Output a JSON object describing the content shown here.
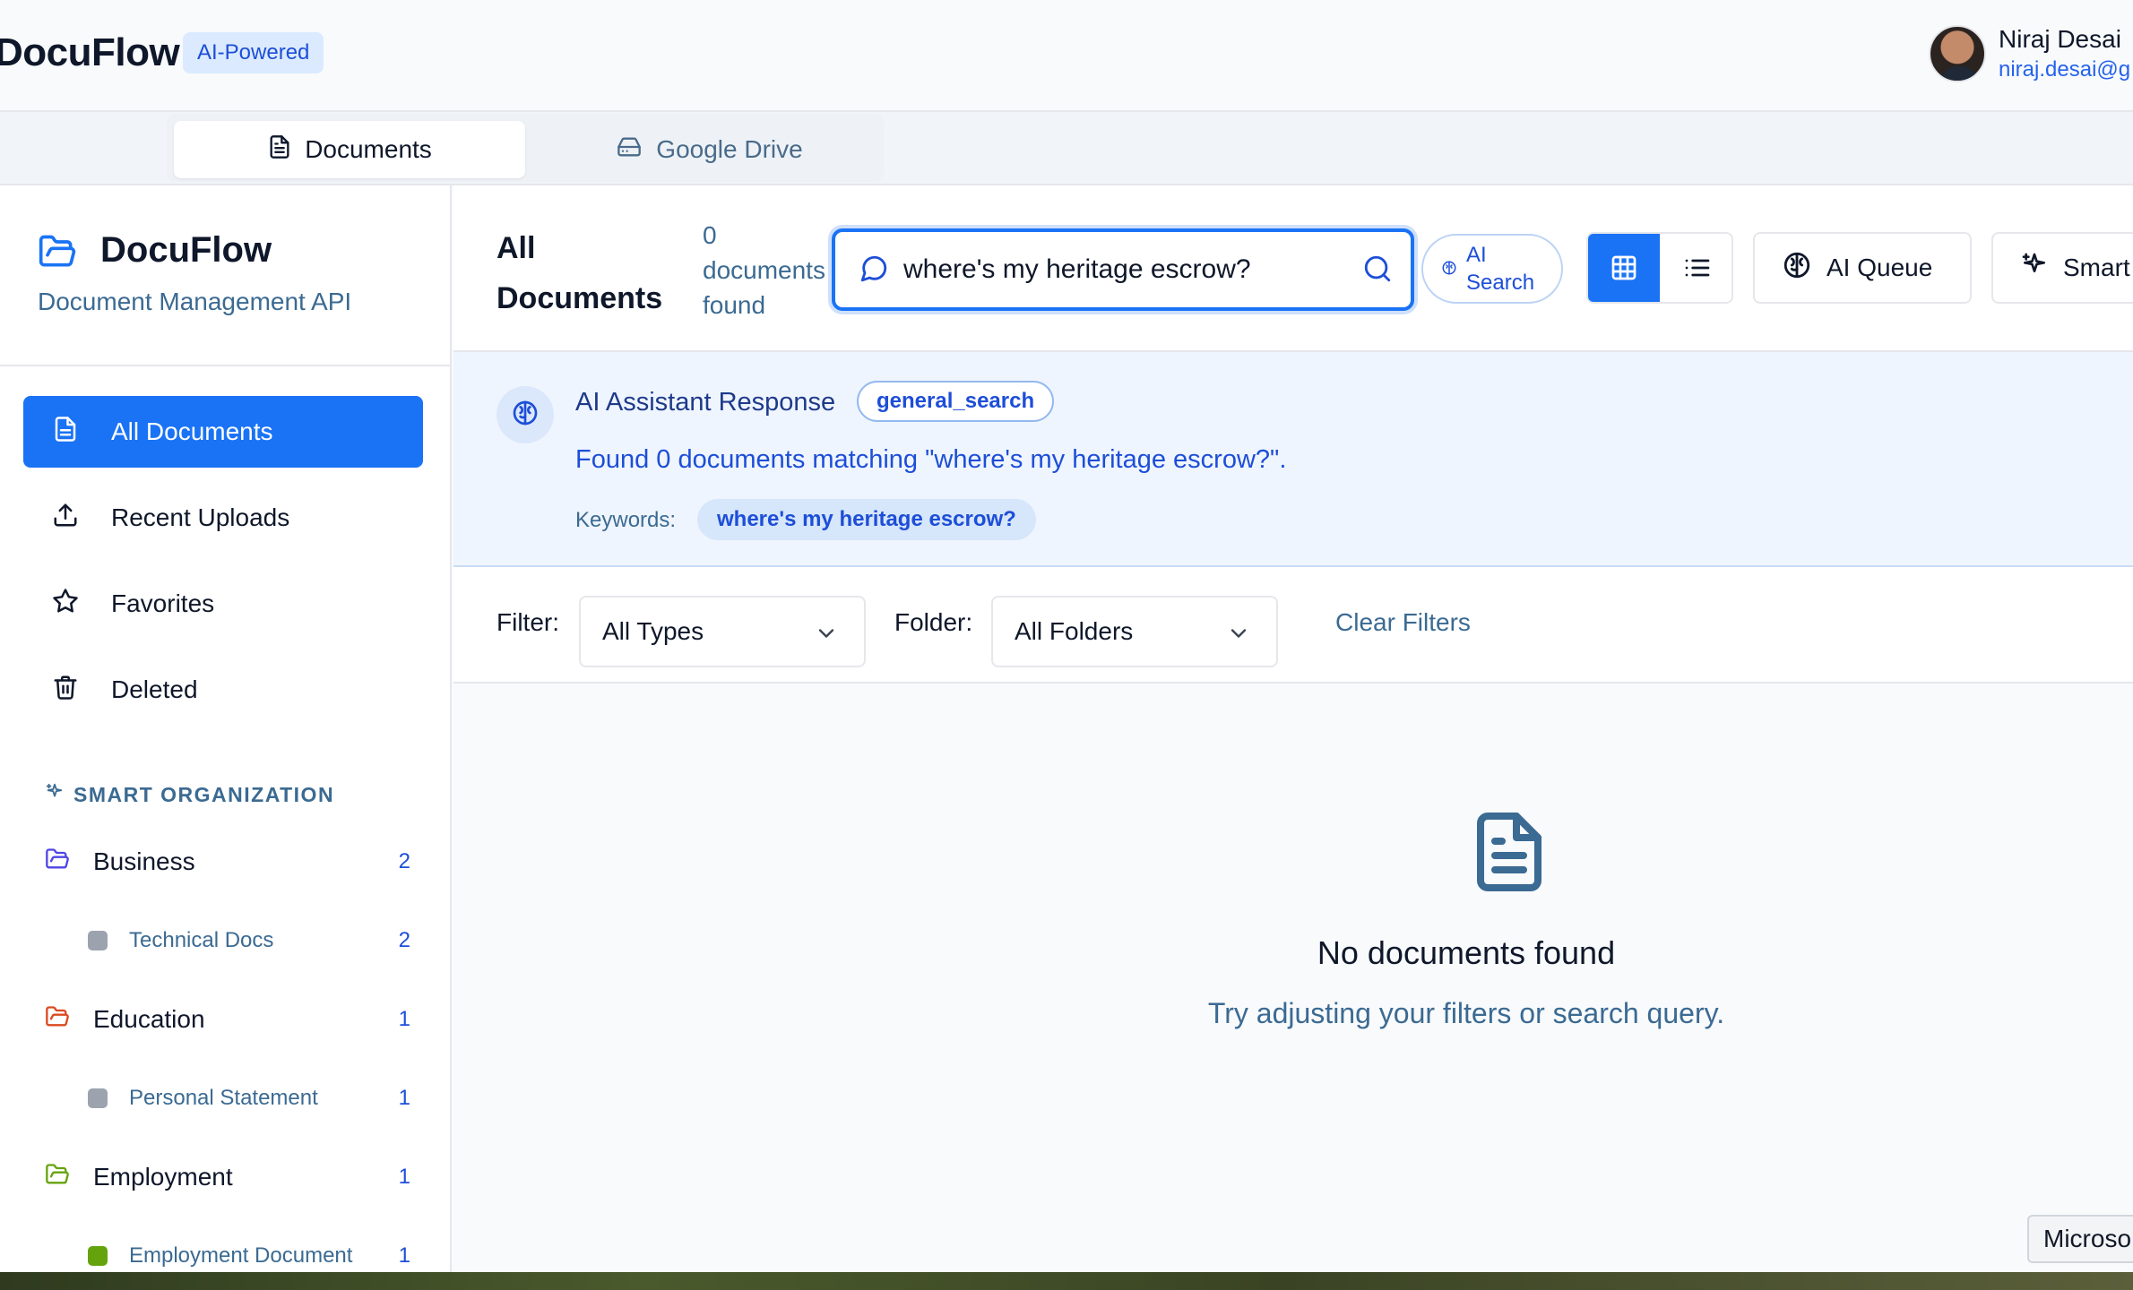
{
  "app": {
    "brand": "DocuFlow",
    "badge": "AI-Powered",
    "user": {
      "name": "Niraj Desai",
      "email": "niraj.desai@g"
    }
  },
  "tabs": [
    {
      "label": "Documents",
      "icon": "file-text-icon",
      "active": true
    },
    {
      "label": "Google Drive",
      "icon": "hard-drive-icon",
      "active": false
    }
  ],
  "sidebar": {
    "title": "DocuFlow",
    "subtitle": "Document Management API",
    "nav": [
      {
        "label": "All Documents",
        "icon": "file-text-icon",
        "active": true
      },
      {
        "label": "Recent Uploads",
        "icon": "upload-icon",
        "active": false
      },
      {
        "label": "Favorites",
        "icon": "star-icon",
        "active": false
      },
      {
        "label": "Deleted",
        "icon": "trash-icon",
        "active": false
      }
    ],
    "smart_heading": "SMART ORGANIZATION",
    "categories": [
      {
        "label": "Business",
        "count": "2",
        "color": "#4f46e5",
        "sub": {
          "label": "Technical Docs",
          "count": "2",
          "color": "#9ca3af"
        }
      },
      {
        "label": "Education",
        "count": "1",
        "color": "#dc4a1f",
        "sub": {
          "label": "Personal Statement",
          "count": "1",
          "color": "#9ca3af"
        }
      },
      {
        "label": "Employment",
        "count": "1",
        "color": "#65a30d",
        "sub": {
          "label": "Employment Document",
          "count": "1",
          "color": "#65a30d"
        }
      }
    ]
  },
  "toolbar": {
    "title": "All Documents",
    "count_text": "0 documents found",
    "search_value": "where's my heritage escrow?",
    "ai_search_label": "AI Search",
    "ai_queue_label": "AI Queue",
    "smart_label": "Smart"
  },
  "ai_response": {
    "title": "AI Assistant Response",
    "intent": "general_search",
    "message": "Found 0 documents matching \"where's my heritage escrow?\".",
    "keywords_label": "Keywords:",
    "keywords": [
      "where's my heritage escrow?"
    ]
  },
  "filters": {
    "filter_label": "Filter:",
    "filter_value": "All Types",
    "folder_label": "Folder:",
    "folder_value": "All Folders",
    "clear_label": "Clear Filters"
  },
  "empty_state": {
    "title": "No documents found",
    "hint": "Try adjusting your filters or search query."
  },
  "taskbar": {
    "chip": "Microso"
  },
  "colors": {
    "accent": "#1a73f5",
    "muted": "#3b6a92"
  }
}
